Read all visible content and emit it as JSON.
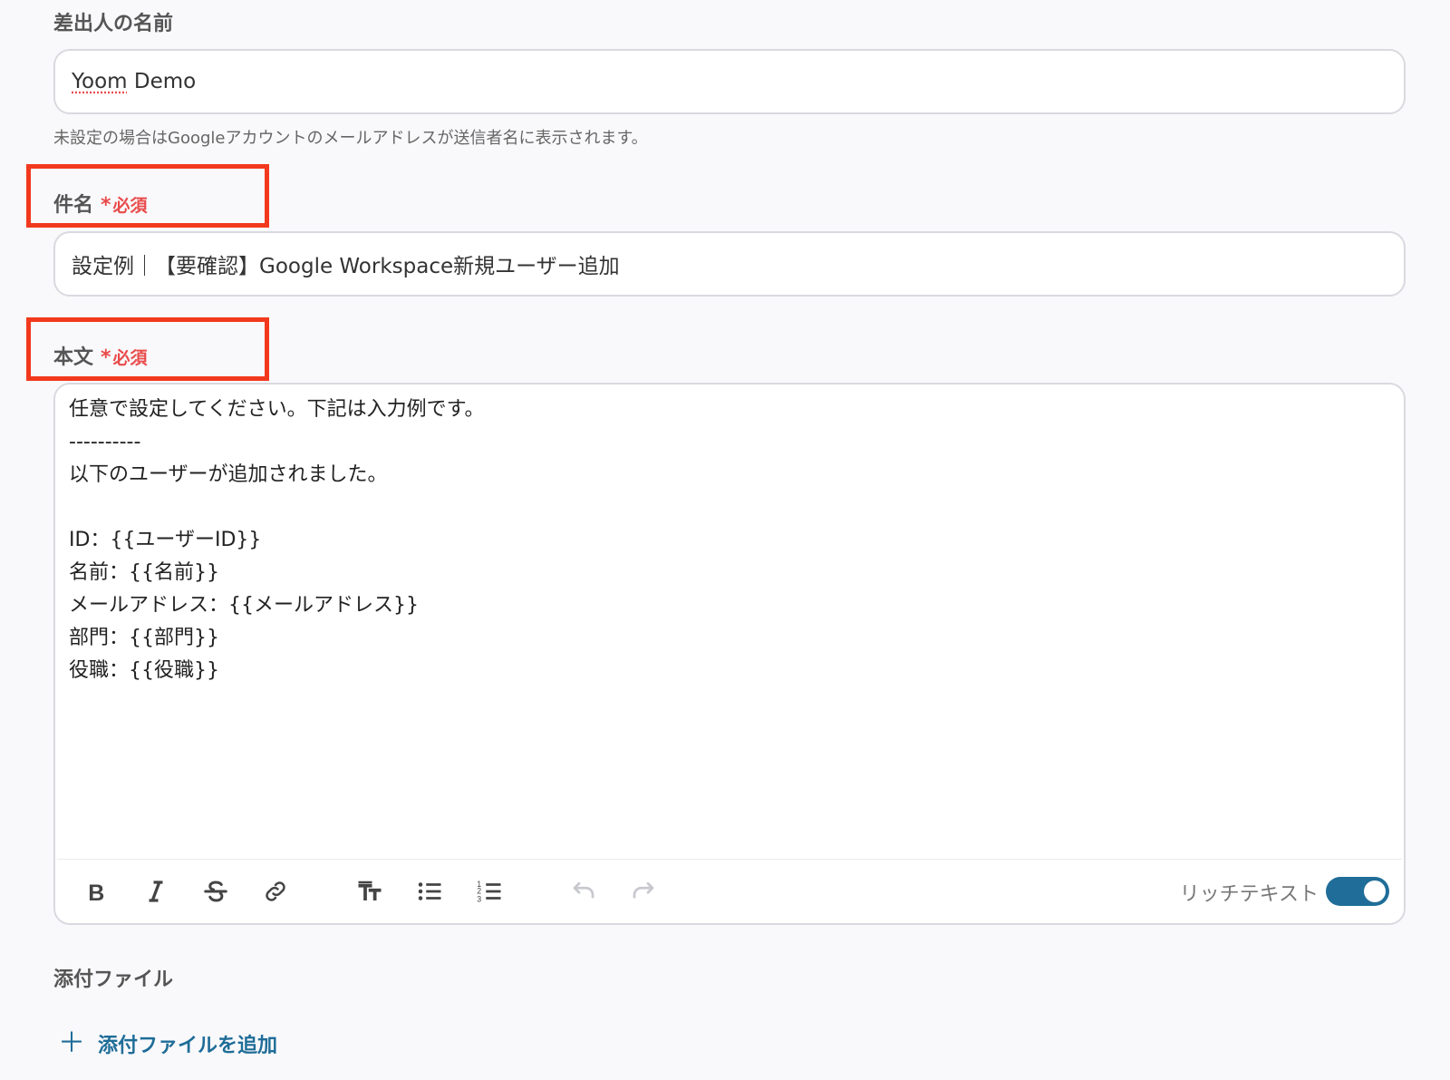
{
  "sender": {
    "label": "差出人の名前",
    "value_word1": "Yoom",
    "value_word2": " Demo",
    "hint": "未設定の場合はGoogleアカウントのメールアドレスが送信者名に表示されます。"
  },
  "subject": {
    "label": "件名",
    "required_star": "*",
    "required_text": "必須",
    "value": "設定例｜【要確認】Google Workspace新規ユーザー追加"
  },
  "body": {
    "label": "本文",
    "required_star": "*",
    "required_text": "必須",
    "lines": [
      "任意で設定してください。下記は入力例です。",
      "----------",
      "以下のユーザーが追加されました。",
      "",
      "ID：{{ユーザーID}}",
      "名前：{{名前}}",
      "メールアドレス：{{メールアドレス}}",
      "部門：{{部門}}",
      "役職：{{役職}}"
    ]
  },
  "toolbar": {
    "icons": [
      "bold-icon",
      "italic-icon",
      "strikethrough-icon",
      "link-icon",
      "text-size-icon",
      "bullet-list-icon",
      "numbered-list-icon",
      "undo-icon",
      "redo-icon"
    ],
    "rich_text_label": "リッチテキスト",
    "rich_text_enabled": true
  },
  "attachments": {
    "label": "添付ファイル",
    "add_label": "添付ファイルを追加"
  },
  "colors": {
    "accent": "#1f6d98",
    "required": "#e94b4b",
    "highlight": "#f2391d"
  }
}
